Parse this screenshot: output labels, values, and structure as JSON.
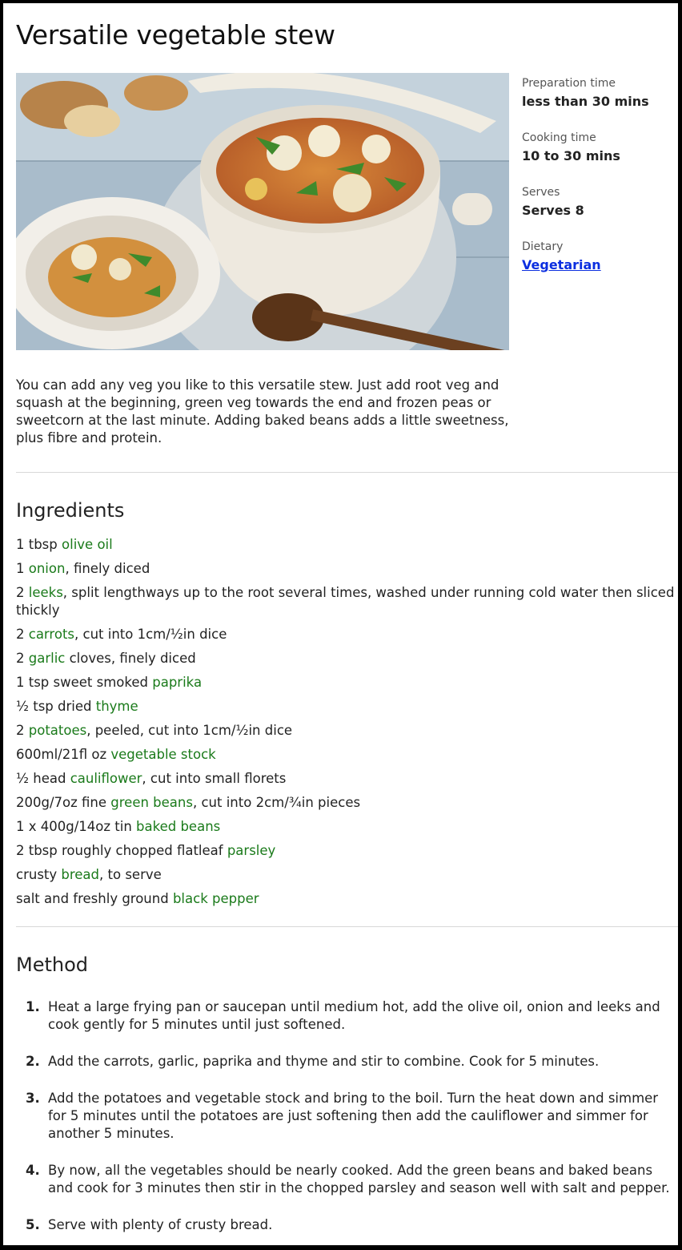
{
  "title": "Versatile vegetable stew",
  "facts": [
    {
      "label": "Preparation time",
      "value": "less than 30 mins"
    },
    {
      "label": "Cooking time",
      "value": "10 to 30 mins"
    },
    {
      "label": "Serves",
      "value": "Serves 8"
    },
    {
      "label": "Dietary",
      "value": "Vegetarian"
    }
  ],
  "intro": "You can add any veg you like to this versatile stew. Just add root veg and squash at the beginning, green veg towards the end and frozen peas or sweetcorn at the last minute. Adding baked beans adds a little sweetness, plus fibre and protein.",
  "ingredients_heading": "Ingredients",
  "ingredients": [
    {
      "before": "1 tbsp ",
      "link": "olive oil",
      "after": ""
    },
    {
      "before": "1 ",
      "link": "onion",
      "after": ", finely diced"
    },
    {
      "before": "2 ",
      "link": "leeks",
      "after": ", split lengthways up to the root several times, washed under running cold water then sliced thickly"
    },
    {
      "before": "2 ",
      "link": "carrots",
      "after": ", cut into 1cm/½in dice"
    },
    {
      "before": "2 ",
      "link": "garlic",
      "after": " cloves, finely diced"
    },
    {
      "before": "1 tsp sweet smoked ",
      "link": "paprika",
      "after": ""
    },
    {
      "before": "½ tsp dried ",
      "link": "thyme",
      "after": ""
    },
    {
      "before": "2 ",
      "link": "potatoes",
      "after": ", peeled, cut into 1cm/½in dice"
    },
    {
      "before": "600ml/21fl oz ",
      "link": "vegetable stock",
      "after": ""
    },
    {
      "before": "½ head ",
      "link": "cauliflower",
      "after": ", cut into small florets"
    },
    {
      "before": "200g/7oz fine ",
      "link": "green beans",
      "after": ", cut into 2cm/¾in pieces"
    },
    {
      "before": "1 x 400g/14oz tin ",
      "link": "baked beans",
      "after": ""
    },
    {
      "before": "2 tbsp roughly chopped flatleaf ",
      "link": "parsley",
      "after": ""
    },
    {
      "before": "crusty ",
      "link": "bread",
      "after": ", to serve"
    },
    {
      "before": "salt and freshly ground ",
      "link": "black pepper",
      "after": ""
    }
  ],
  "method_heading": "Method",
  "method": [
    {
      "num": "1.",
      "text": "Heat a large frying pan or saucepan until medium hot, add the olive oil, onion and leeks and cook gently for 5 minutes until just softened."
    },
    {
      "num": "2.",
      "text": "Add the carrots, garlic, paprika and thyme and stir to combine. Cook for 5 minutes."
    },
    {
      "num": "3.",
      "text": "Add the potatoes and vegetable stock and bring to the boil. Turn the heat down and simmer for 5 minutes until the potatoes are just softening then add the cauliflower and simmer for another 5 minutes."
    },
    {
      "num": "4.",
      "text": "By now, all the vegetables should be nearly cooked. Add the green beans and baked beans and cook for 3 minutes then stir in the chopped parsley and season well with salt and pepper."
    },
    {
      "num": "5.",
      "text": "Serve with plenty of crusty bread."
    }
  ],
  "colors": {
    "ingredient_link": "#1a7a1a",
    "dietary_link": "#0b2ee0"
  }
}
